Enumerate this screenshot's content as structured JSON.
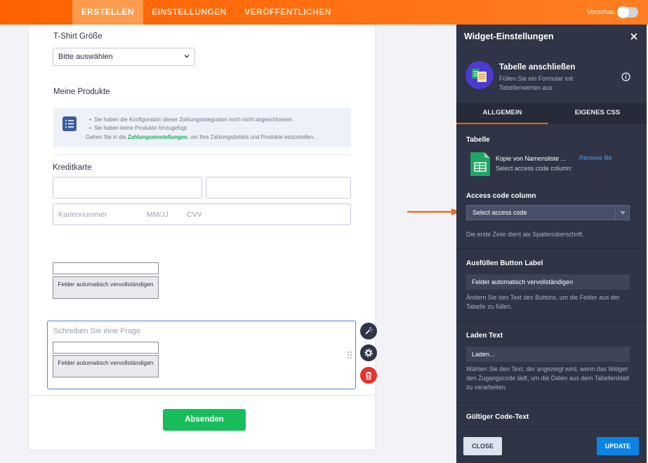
{
  "topbar": {
    "tabs": [
      "ERSTELLEN",
      "EINSTELLUNGEN",
      "VERÖFFENTLICHEN"
    ],
    "active_tab": "ERSTELLEN",
    "preview_label": "Vorschau",
    "preview_on": false,
    "accent_color": "#ff6100"
  },
  "form": {
    "tshirt_label": "T-Shirt Größe",
    "tshirt_select_value": "Bitte auswählen",
    "products_label": "Meine Produkte",
    "info_lines": [
      "Sie haben die Konfiguration dieser Zahlungsintegration noch nicht abgeschlossen.",
      "Sie haben keine Produkte hinzugefügt."
    ],
    "info_hint_before": "Gehen Sie in die",
    "info_hint_link": "Zahlungseinstellungen",
    "info_hint_after": ", um Ihre Zahlungsdetails und Produkte einzustellen.",
    "credit_card_label": "Kreditkarte",
    "card_number_placeholder": "Kartennummer",
    "expiry_placeholder": "MM/JJ",
    "cvv_placeholder": "CVV",
    "autofill_button_label_1": "Felder automatisch vervollständigen",
    "question_placeholder": "Schreiben Sie eine Frage",
    "autofill_button_label_2": "Felder automatisch vervollständigen",
    "submit_label": "Absenden",
    "submit_color": "#18bd5b"
  },
  "panel": {
    "title": "Widget-Einstellungen",
    "widget_name": "Tabelle anschließen",
    "widget_description": "Füllen Sie ein Formular mit Tabellenwerten aus",
    "tabs": [
      "ALLGEMEIN",
      "EIGENES CSS"
    ],
    "active_tab": "ALLGEMEIN",
    "sections": {
      "table_label": "Tabelle",
      "file_name": "Kopie von Namensliste ...",
      "remove_file": "Remove file",
      "file_subtitle": "Select access code column:",
      "access_code_label": "Access code column",
      "access_code_value": "Select access code",
      "access_code_hint": "Die erste Zeile dient als Spaltenüberschrift.",
      "fill_button_label": "Ausfüllen Button Label",
      "fill_button_value": "Felder automatisch vervollständigen",
      "fill_button_hint": "Ändern Sie den Text des Buttons, um die Felder aus der Tabelle zu füllen.",
      "loading_label": "Laden Text",
      "loading_value": "Laden...",
      "loading_hint": "Wählen Sie den Text, der angezeigt wird, wenn das Widget den Zugangscode lädt, um die Daten aus dem Tabellenblatt zu verarbeiten.",
      "valid_code_label": "Gültiger Code-Text"
    },
    "close_label": "CLOSE",
    "update_label": "UPDATE",
    "update_color": "#0a84e4"
  }
}
